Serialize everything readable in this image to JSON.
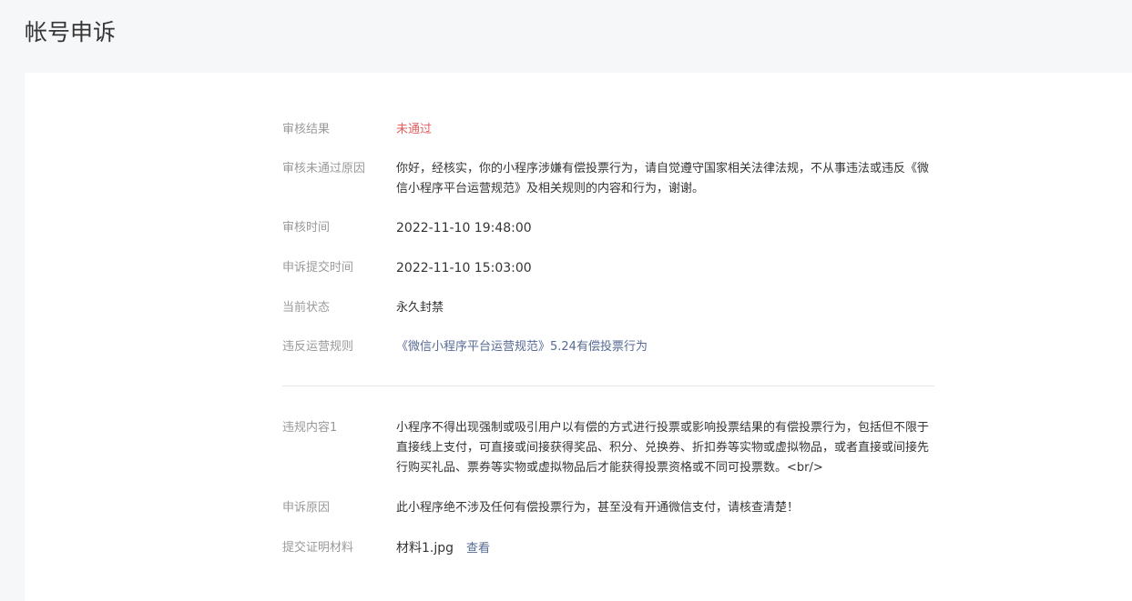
{
  "page": {
    "title": "帐号申诉"
  },
  "review": {
    "result_label": "审核结果",
    "result_value": "未通过",
    "reason_label": "审核未通过原因",
    "reason_value": "你好，经核实，你的小程序涉嫌有偿投票行为，请自觉遵守国家相关法律法规，不从事违法或违反《微信小程序平台运营规范》及相关规则的内容和行为，谢谢。",
    "review_time_label": "审核时间",
    "review_time_value": "2022-11-10 19:48:00",
    "submit_time_label": "申诉提交时间",
    "submit_time_value": "2022-11-10 15:03:00",
    "status_label": "当前状态",
    "status_value": "永久封禁",
    "rule_label": "违反运营规则",
    "rule_value": "《微信小程序平台运营规范》5.24有偿投票行为"
  },
  "violation": {
    "content_label": "违规内容1",
    "content_value": "小程序不得出现强制或吸引用户以有偿的方式进行投票或影响投票结果的有偿投票行为，包括但不限于直接线上支付，可直接或间接获得奖品、积分、兑换券、折扣券等实物或虚拟物品，或者直接或间接先行购买礼品、票券等实物或虚拟物品后才能获得投票资格或不同可投票数。<br/>",
    "appeal_reason_label": "申诉原因",
    "appeal_reason_value": "此小程序绝不涉及任何有偿投票行为，甚至没有开通微信支付，请核查清楚！",
    "material_label": "提交证明材料",
    "material_file": "材料1.jpg",
    "material_view": "查看"
  },
  "colors": {
    "fail": "#e15f5f",
    "link": "#576b95",
    "label": "#9a9a9a",
    "text": "#353535"
  }
}
